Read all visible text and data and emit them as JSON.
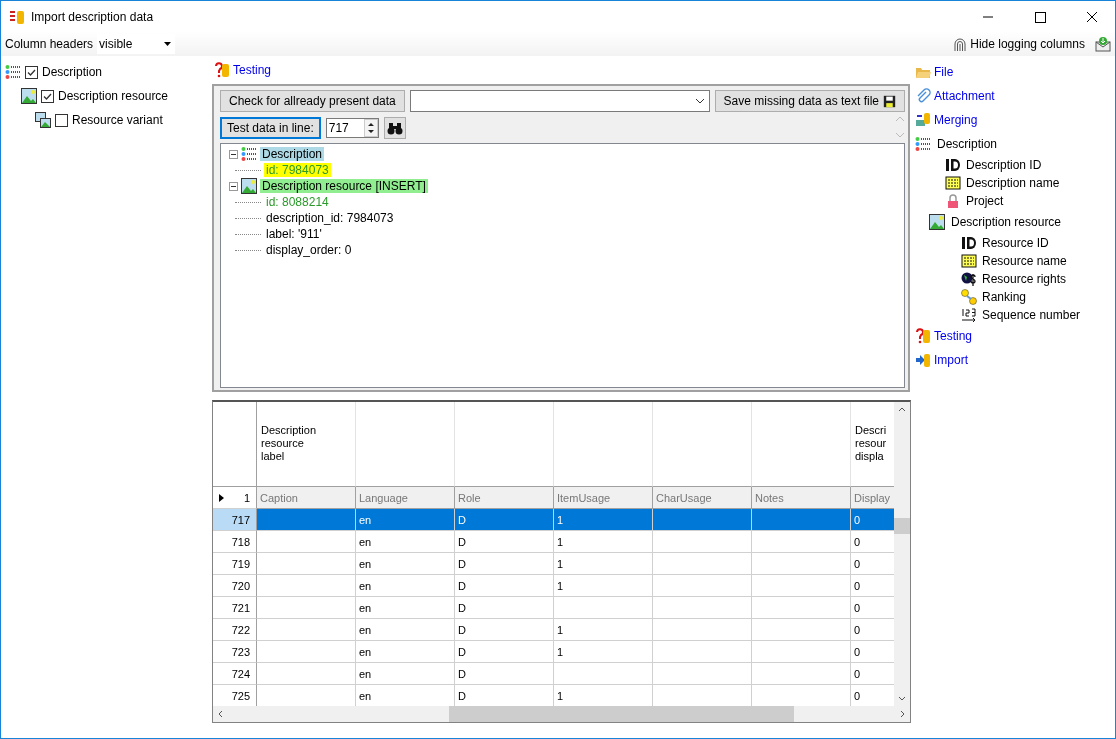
{
  "window": {
    "title": "Import description data"
  },
  "column_headers": {
    "label": "Column headers",
    "value": "visible"
  },
  "hide_logging": {
    "label": "Hide logging columns"
  },
  "tables_tree": [
    {
      "label": "Description",
      "checked": true,
      "children": [
        {
          "label": "Description resource",
          "checked": true,
          "children": [
            {
              "label": "Resource variant",
              "checked": false
            }
          ]
        }
      ]
    }
  ],
  "testing_title": "Testing",
  "test_panel": {
    "check_button": "Check for allready present data",
    "save_button": "Save missing data as text file",
    "line_button": "Test data in line:",
    "line_value": "717",
    "tree": [
      {
        "label": "Description",
        "kind": "table",
        "color": "#add8e6",
        "children": [
          {
            "label": "id: 7984073",
            "kind": "key",
            "color": "#ffff00"
          }
        ]
      },
      {
        "label": "Description resource [INSERT]",
        "kind": "table",
        "color": "#90ee90",
        "children": [
          {
            "label": "id: 8088214",
            "kind": "key"
          },
          {
            "label": "description_id: 7984073",
            "kind": "value"
          },
          {
            "label": "label: '911'",
            "kind": "value"
          },
          {
            "label": "display_order: 0",
            "kind": "value"
          }
        ]
      }
    ]
  },
  "grid": {
    "first_header": [
      "Description",
      "resource",
      "label"
    ],
    "last_header": [
      "Descri",
      "resour",
      "displa"
    ],
    "template_row": {
      "number": "1",
      "cells": [
        "Caption",
        "Language",
        "Role",
        "ItemUsage",
        "CharUsage",
        "Notes",
        "Display"
      ]
    },
    "rows": [
      {
        "number": "717",
        "selected": true,
        "cells": [
          "",
          "en",
          "D",
          "1",
          "",
          "",
          "0"
        ]
      },
      {
        "number": "718",
        "selected": false,
        "cells": [
          "",
          "en",
          "D",
          "1",
          "",
          "",
          "0"
        ]
      },
      {
        "number": "719",
        "selected": false,
        "cells": [
          "",
          "en",
          "D",
          "1",
          "",
          "",
          "0"
        ]
      },
      {
        "number": "720",
        "selected": false,
        "cells": [
          "",
          "en",
          "D",
          "1",
          "",
          "",
          "0"
        ]
      },
      {
        "number": "721",
        "selected": false,
        "cells": [
          "",
          "en",
          "D",
          "",
          "",
          "",
          "0"
        ]
      },
      {
        "number": "722",
        "selected": false,
        "cells": [
          "",
          "en",
          "D",
          "1",
          "",
          "",
          "0"
        ]
      },
      {
        "number": "723",
        "selected": false,
        "cells": [
          "",
          "en",
          "D",
          "1",
          "",
          "",
          "0"
        ]
      },
      {
        "number": "724",
        "selected": false,
        "cells": [
          "",
          "en",
          "D",
          "",
          "",
          "",
          "0"
        ]
      },
      {
        "number": "725",
        "selected": false,
        "cells": [
          "",
          "en",
          "D",
          "1",
          "",
          "",
          "0"
        ]
      }
    ]
  },
  "nav": [
    {
      "label": "File",
      "kind": "link"
    },
    {
      "label": "Attachment",
      "kind": "link"
    },
    {
      "label": "Merging",
      "kind": "link"
    },
    {
      "label": "Description",
      "kind": "table",
      "children": [
        {
          "label": "Description ID",
          "kind": "field"
        },
        {
          "label": "Description name",
          "kind": "field"
        },
        {
          "label": "Project",
          "kind": "field"
        },
        {
          "label": "Description resource",
          "kind": "table",
          "children": [
            {
              "label": "Resource ID",
              "kind": "field"
            },
            {
              "label": "Resource name",
              "kind": "field"
            },
            {
              "label": "Resource rights",
              "kind": "field"
            },
            {
              "label": "Ranking",
              "kind": "field"
            },
            {
              "label": "Sequence number",
              "kind": "field"
            }
          ]
        }
      ]
    },
    {
      "label": "Testing",
      "kind": "link"
    },
    {
      "label": "Import",
      "kind": "link"
    }
  ]
}
